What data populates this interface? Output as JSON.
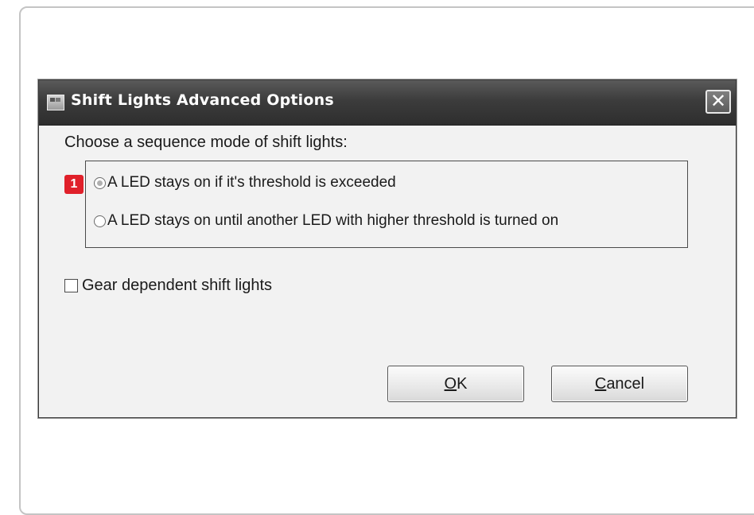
{
  "dialog": {
    "title": "Shift Lights Advanced Options",
    "app_icon": "shift-lights-app-icon",
    "close_icon": "close-x-icon",
    "close_label": "✕"
  },
  "sequence": {
    "prompt": "Choose a sequence mode of shift lights:",
    "badge": "1",
    "badge_color": "#e0202a",
    "options": [
      {
        "label": "A LED stays on if it's threshold is exceeded",
        "selected": true
      },
      {
        "label": "A LED stays on until another LED with higher threshold is turned on",
        "selected": false
      }
    ]
  },
  "gear_dependent": {
    "label": "Gear dependent shift lights",
    "checked": false
  },
  "buttons": {
    "ok_mnemonic": "O",
    "ok_rest": "K",
    "cancel_mnemonic": "C",
    "cancel_rest": "ancel"
  }
}
